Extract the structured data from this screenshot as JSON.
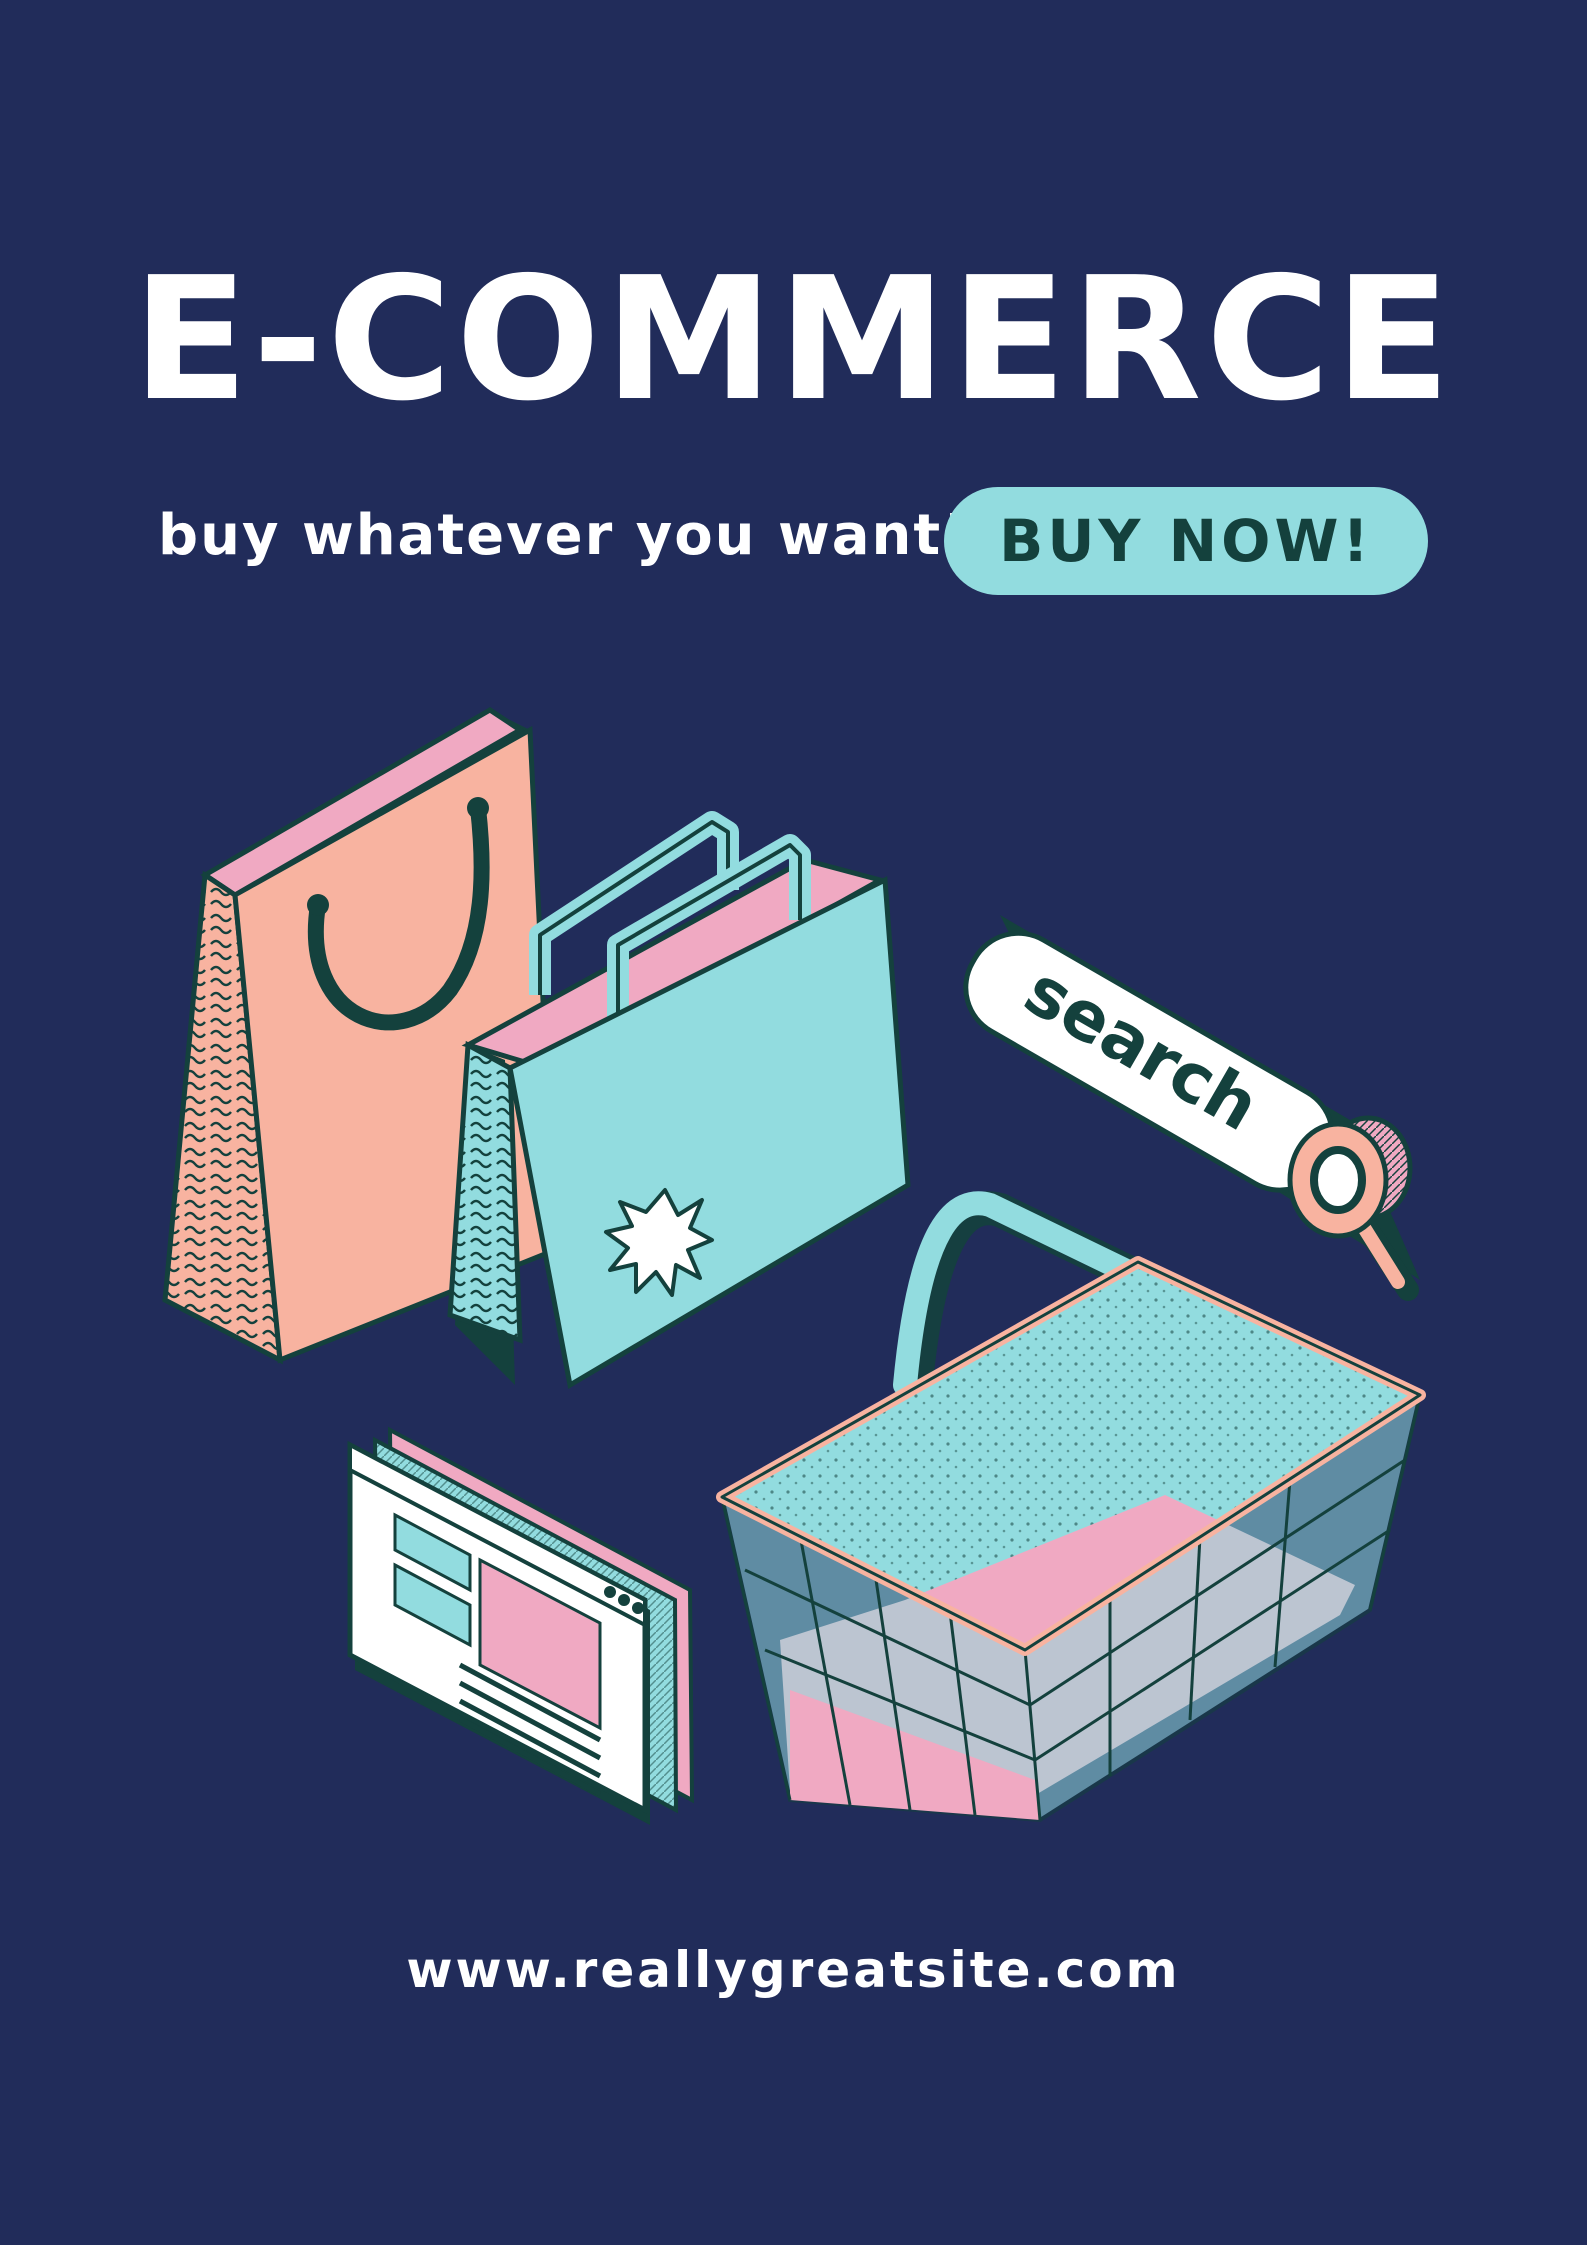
{
  "title": "E-COMMERCE",
  "tagline": "buy whatever you want!",
  "cta": {
    "label": "BUY NOW!"
  },
  "search_bar": {
    "text": "search"
  },
  "website": "www.reallygreatsite.com",
  "icons": [
    "shopping-bag-icon",
    "shopping-bag-icon",
    "search-bar-icon",
    "magnifier-icon",
    "shopping-basket-icon",
    "web-page-icon"
  ],
  "colors": {
    "background": "#212c5a",
    "teal": "#92dcdf",
    "pink": "#f0a9c2",
    "peach": "#f8b3a0",
    "dark": "#14413d",
    "white": "#ffffff"
  }
}
